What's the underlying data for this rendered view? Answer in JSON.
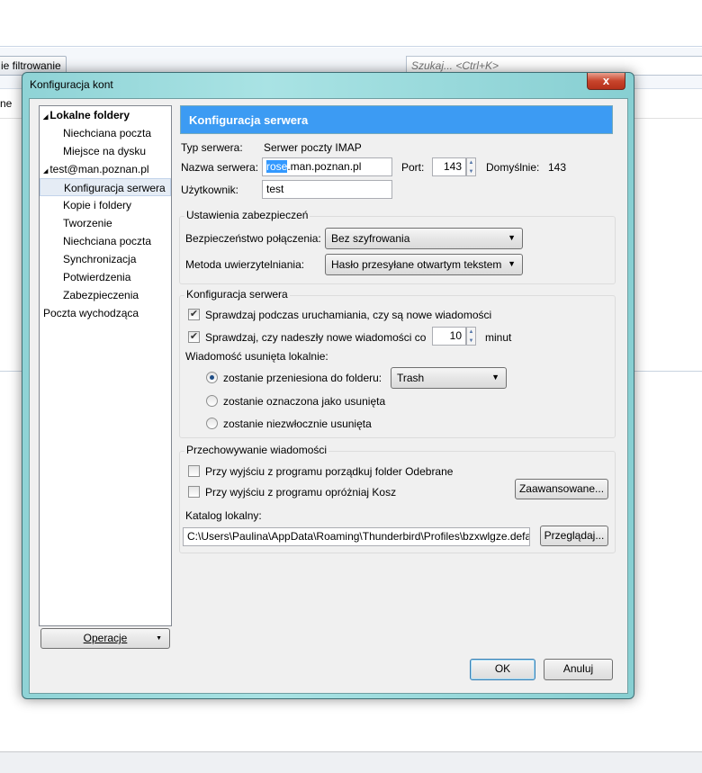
{
  "background": {
    "filter_button": "ie filtrowanie",
    "search_placeholder": "Szukaj... <Ctrl+K>",
    "row_text": "ne"
  },
  "dialog": {
    "title": "Konfiguracja kont",
    "close_label": "x",
    "tree": [
      {
        "label": "Lokalne foldery",
        "level": 0,
        "bold": true,
        "expander": true
      },
      {
        "label": "Niechciana poczta",
        "level": 1
      },
      {
        "label": "Miejsce na dysku",
        "level": 1
      },
      {
        "label": "test@man.poznan.pl",
        "level": 0,
        "expander": true
      },
      {
        "label": "Konfiguracja serwera",
        "level": 1,
        "selected": true
      },
      {
        "label": "Kopie i foldery",
        "level": 1
      },
      {
        "label": "Tworzenie",
        "level": 1
      },
      {
        "label": "Niechciana poczta",
        "level": 1
      },
      {
        "label": "Synchronizacja",
        "level": 1
      },
      {
        "label": "Potwierdzenia",
        "level": 1
      },
      {
        "label": "Zabezpieczenia",
        "level": 1
      },
      {
        "label": "Poczta wychodząca",
        "level": 0
      }
    ],
    "operations_label": "Operacje",
    "banner": "Konfiguracja serwera",
    "server_type_label": "Typ serwera:",
    "server_type_value": "Serwer poczty IMAP",
    "server_name_label": "Nazwa serwera:",
    "server_name_selected": "rose",
    "server_name_rest": ".man.poznan.pl",
    "port_label": "Port:",
    "port_value": "143",
    "default_label": "Domyślnie:",
    "default_value": "143",
    "user_label": "Użytkownik:",
    "user_value": "test",
    "security": {
      "title": "Ustawienia zabezpieczeń",
      "conn_label": "Bezpieczeństwo połączenia:",
      "conn_value": "Bez szyfrowania",
      "auth_label": "Metoda uwierzytelniania:",
      "auth_value": "Hasło przesyłane otwartym tekstem"
    },
    "server": {
      "title": "Konfiguracja serwera",
      "check_startup": "Sprawdzaj podczas uruchamiania, czy są nowe wiadomości",
      "check_startup_checked": true,
      "check_every": "Sprawdzaj, czy nadeszły nowe wiadomości co",
      "check_every_checked": true,
      "minutes_value": "10",
      "minutes_label": "minut",
      "deleted_label": "Wiadomość usunięta lokalnie:",
      "radio_move": "zostanie przeniesiona do folderu:",
      "folder_value": "Trash",
      "radio_mark": "zostanie oznaczona jako usunięta",
      "radio_delete": "zostanie niezwłocznie usunięta",
      "selected_radio": "move"
    },
    "storage": {
      "title": "Przechowywanie wiadomości",
      "compact": "Przy wyjściu z programu porządkuj folder Odebrane",
      "compact_checked": false,
      "empty_trash": "Przy wyjściu z programu opróżniaj Kosz",
      "empty_trash_checked": false,
      "advanced_label": "Zaawansowane...",
      "local_dir_label": "Katalog lokalny:",
      "local_dir_value": "C:\\Users\\Paulina\\AppData\\Roaming\\Thunderbird\\Profiles\\bzxwlgze.default\\ImapMail\\rose.man.poznan.pl",
      "browse_label": "Przeglądaj..."
    },
    "ok_label": "OK",
    "cancel_label": "Anuluj"
  }
}
